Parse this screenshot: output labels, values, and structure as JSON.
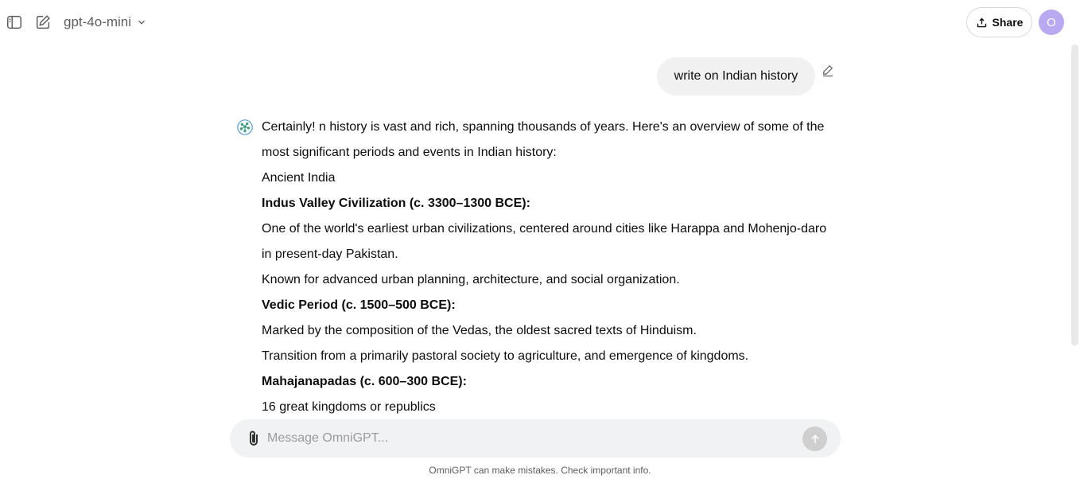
{
  "header": {
    "model_name": "gpt-4o-mini",
    "share_label": "Share",
    "avatar_initial": "O"
  },
  "conversation": {
    "user_message": "write on Indian history",
    "assistant_lines": [
      {
        "text": "Certainly! n history is vast and rich, spanning thousands of years. Here's an overview of some of the most significant periods and events in Indian history:",
        "bold": false
      },
      {
        "text": "Ancient India",
        "bold": false
      },
      {
        "text": "Indus Valley Civilization (c. 3300–1300 BCE):",
        "bold": true
      },
      {
        "text": "One of the world's earliest urban civilizations, centered around cities like Harappa and Mohenjo-daro in present-day Pakistan.",
        "bold": false
      },
      {
        "text": "Known for advanced urban planning, architecture, and social organization.",
        "bold": false
      },
      {
        "text": "Vedic Period (c. 1500–500 BCE):",
        "bold": true
      },
      {
        "text": "Marked by the composition of the Vedas, the oldest sacred texts of Hinduism.",
        "bold": false
      },
      {
        "text": "Transition from a primarily pastoral society to agriculture, and emergence of kingdoms.",
        "bold": false
      },
      {
        "text": "Mahajanapadas (c. 600–300 BCE):",
        "bold": true
      },
      {
        "text": "16 great kingdoms or republics",
        "bold": false
      }
    ]
  },
  "composer": {
    "placeholder": "Message OmniGPT..."
  },
  "footer": {
    "disclaimer": "OmniGPT can make mistakes. Check important info."
  },
  "colors": {
    "avatar": "#b8a9f2",
    "bubble": "#f1f1f1",
    "composer": "#f1f2f4",
    "send_disabled": "#cfcfcf"
  }
}
